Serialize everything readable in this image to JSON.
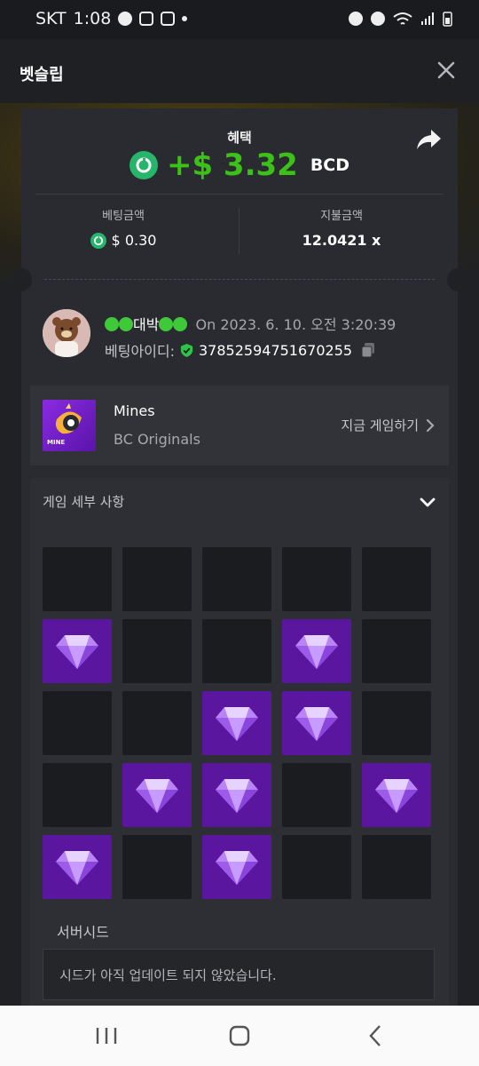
{
  "status_bar": {
    "carrier": "SKT",
    "time": "1:08"
  },
  "header": {
    "title": "벳슬립"
  },
  "summary": {
    "benefit_label": "혜택",
    "profit": "+$ 3.32",
    "currency": "BCD",
    "bet_amount_label": "베팅금액",
    "bet_amount": "$ 0.30",
    "payout_label": "지불금액",
    "payout": "12.0421 x"
  },
  "bet": {
    "username": "대박",
    "time_text": "On 2023. 6. 10. 오전 3:20:39",
    "bet_id_label": "베팅아이디:",
    "bet_id": "37852594751670255"
  },
  "game": {
    "name": "Mines",
    "provider": "BC Originals",
    "thumb_text": "MINE",
    "play_label": "지금 게임하기"
  },
  "details": {
    "title": "게임 세부 사항",
    "grid": [
      [
        "empty",
        "empty",
        "empty",
        "empty",
        "empty"
      ],
      [
        "gem",
        "empty",
        "empty",
        "gem",
        "empty"
      ],
      [
        "empty",
        "empty",
        "gem",
        "gem",
        "empty"
      ],
      [
        "empty",
        "gem",
        "gem",
        "empty",
        "gem"
      ],
      [
        "gem",
        "empty",
        "gem",
        "empty",
        "empty"
      ]
    ],
    "server_seed_label": "서버시드",
    "server_seed_value": "시드가 아직 업데이트 되지 않았습니다."
  },
  "colors": {
    "profit": "#3bc117",
    "gem_tile": "#5a169e",
    "coin": "#26b56a"
  }
}
